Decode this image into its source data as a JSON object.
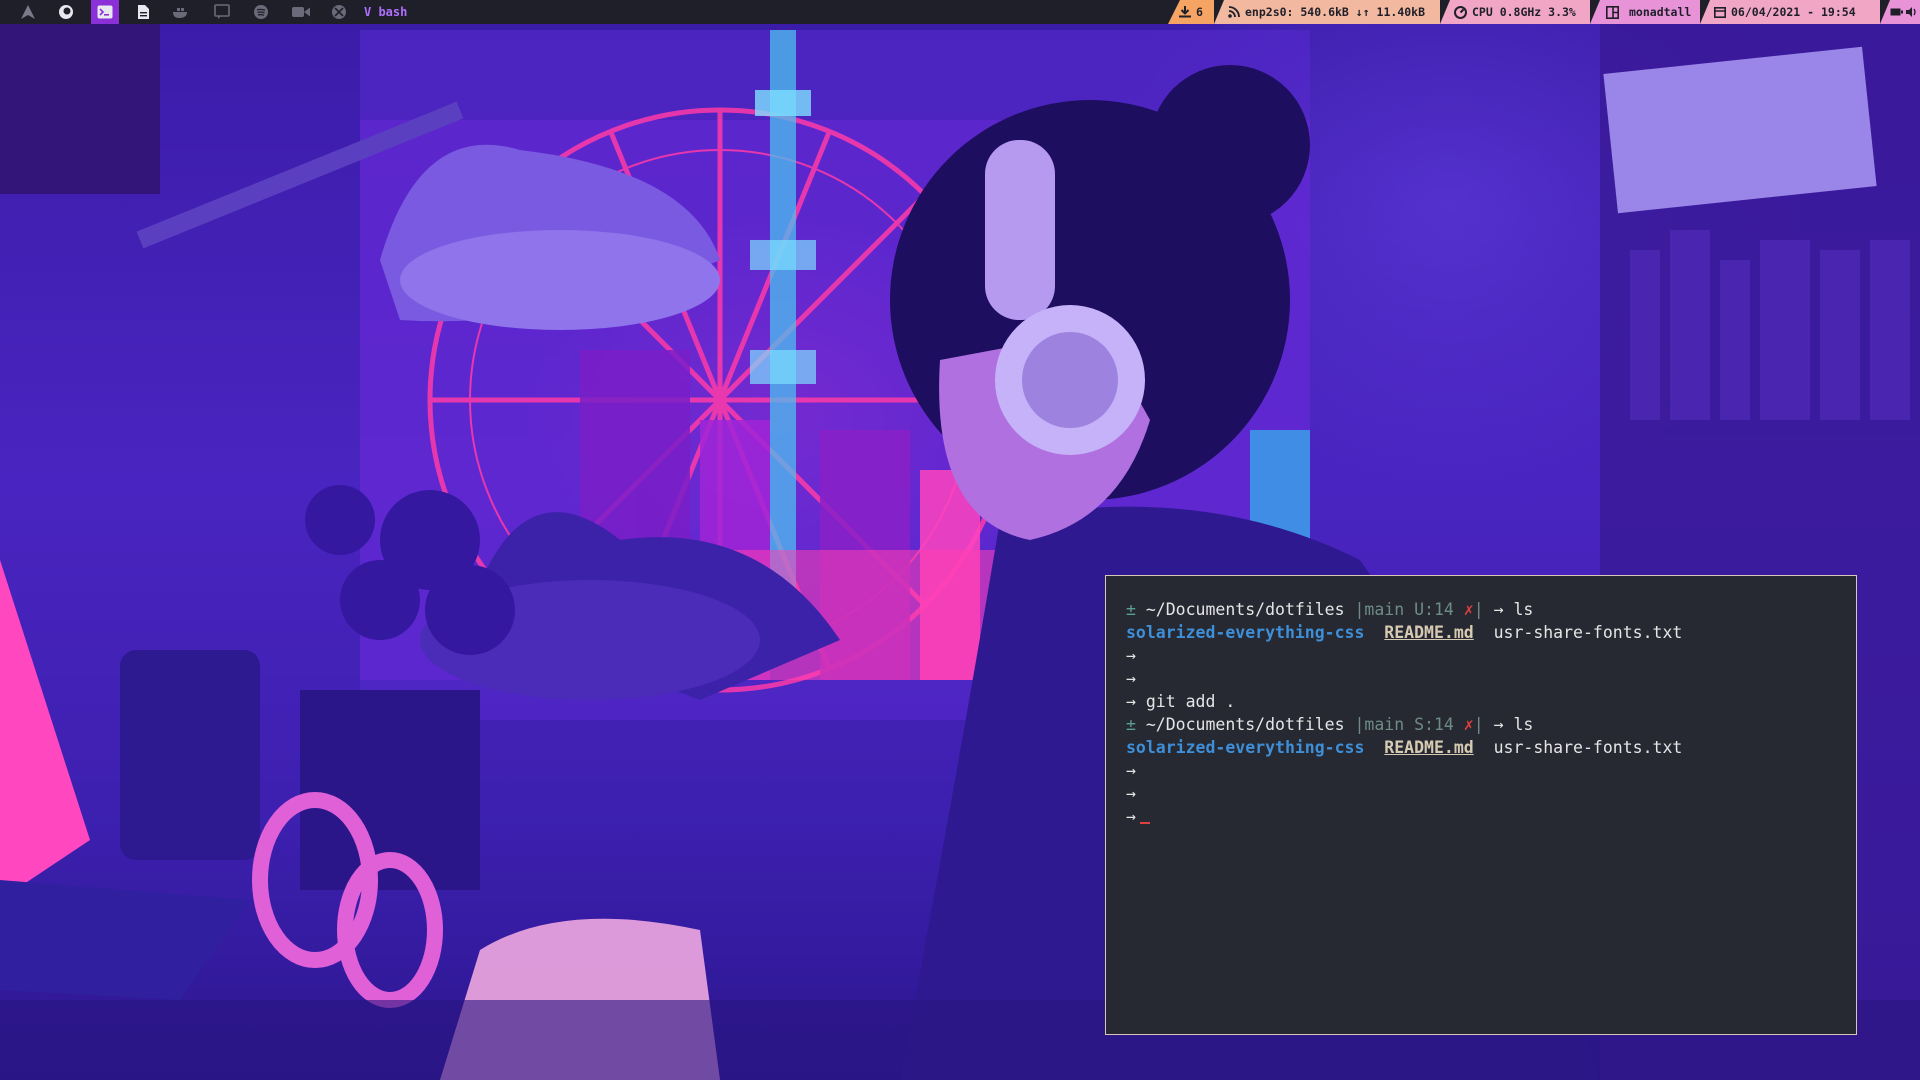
{
  "bar": {
    "window_title": "V bash",
    "workspace_icons": [
      "arch-icon",
      "firefox-icon",
      "terminal-icon",
      "document-icon",
      "docker-icon",
      "chat-icon",
      "spotify-icon",
      "video-icon",
      "steam-icon"
    ],
    "updates": "6",
    "network": "enp2s0: 540.6kB ↓↑ 11.40kB",
    "cpu": "CPU 0.8GHz 3.3%",
    "layout": "monadtall",
    "datetime": "06/04/2021 - 19:54",
    "colors": {
      "bar_bg": "#1f1f29",
      "accent": "#8b2fd8",
      "seg_orange": "#f5a463",
      "seg_peach": "#f2b8a0",
      "seg_pink": "#f0a6c4",
      "seg_magenta": "#e892d8"
    }
  },
  "terminal": {
    "line1": {
      "sym": "±",
      "path": "~/Documents/dotfiles",
      "branch": "|main U:14",
      "x": "✗",
      "bar": "|",
      "arrow": "→",
      "cmd": "ls"
    },
    "list1": {
      "dir": "solarized-everything-css",
      "f1": "README.md",
      "f2": "usr-share-fonts.txt"
    },
    "empty_prompts": [
      "→",
      "→"
    ],
    "cmd2": {
      "arrow": "→",
      "cmd": "git add ."
    },
    "line2": {
      "sym": "±",
      "path": "~/Documents/dotfiles",
      "branch": "|main S:14",
      "x": "✗",
      "bar": "|",
      "arrow": "→",
      "cmd": "ls"
    },
    "list2": {
      "dir": "solarized-everything-css",
      "f1": "README.md",
      "f2": "usr-share-fonts.txt"
    },
    "trailing_prompts": [
      "→",
      "→",
      "→"
    ]
  }
}
